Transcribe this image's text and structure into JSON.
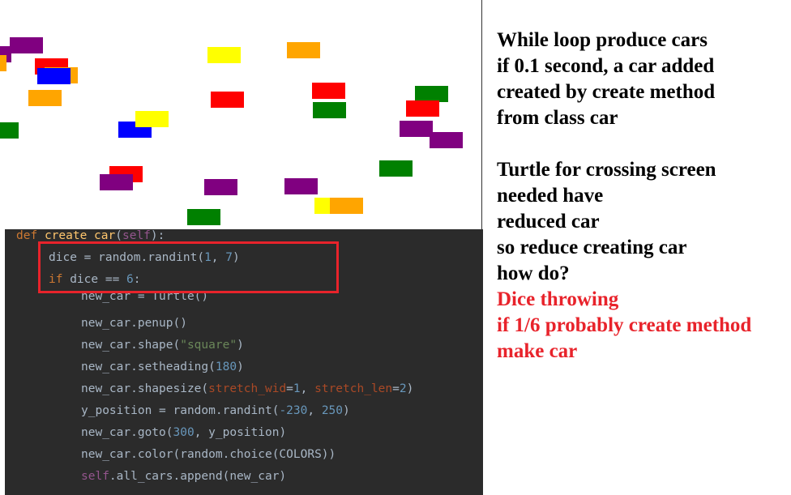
{
  "canvas": {
    "cars": [
      {
        "color": "#800080"
      },
      {
        "color": "#800080"
      },
      {
        "color": "#ffa500"
      },
      {
        "color": "#ff0000"
      },
      {
        "color": "#ffa500"
      },
      {
        "color": "#0000ff"
      },
      {
        "color": "#ffff00"
      },
      {
        "color": "#ffa500"
      },
      {
        "color": "#ffa500"
      },
      {
        "color": "#ff0000"
      },
      {
        "color": "#ff0000"
      },
      {
        "color": "#008000"
      },
      {
        "color": "#008000"
      },
      {
        "color": "#ff0000"
      },
      {
        "color": "#008000"
      },
      {
        "color": "#0000ff"
      },
      {
        "color": "#ffff00"
      },
      {
        "color": "#800080"
      },
      {
        "color": "#800080"
      },
      {
        "color": "#ff0000"
      },
      {
        "color": "#800080"
      },
      {
        "color": "#800080"
      },
      {
        "color": "#800080"
      },
      {
        "color": "#008000"
      },
      {
        "color": "#ffff00"
      },
      {
        "color": "#ffa500"
      },
      {
        "color": "#008000"
      },
      {
        "color": "#ffff00"
      }
    ]
  },
  "code": {
    "def_kw": "def",
    "def_name": "create_car",
    "def_paren_open": "(",
    "def_self": "self",
    "def_paren_close": "):",
    "l1_a": "dice = random.randint(",
    "l1_n1": "1",
    "l1_sep": ", ",
    "l1_n2": "7",
    "l1_end": ")",
    "l2_kw": "if",
    "l2_a": " dice == ",
    "l2_n": "6",
    "l2_end": ":",
    "l3": "new_car = Turtle()",
    "l4": "new_car.penup()",
    "l5_a": "new_car.shape(",
    "l5_s": "\"square\"",
    "l5_end": ")",
    "l6_a": "new_car.setheading(",
    "l6_n": "180",
    "l6_end": ")",
    "l7_a": "new_car.shapesize(",
    "l7_p1": "stretch_wid",
    "l7_eq1": "=",
    "l7_n1": "1",
    "l7_sep": ", ",
    "l7_p2": "stretch_len",
    "l7_eq2": "=",
    "l7_n2": "2",
    "l7_end": ")",
    "l8_a": "y_position = random.randint(",
    "l8_n1": "-230",
    "l8_sep": ", ",
    "l8_n2": "250",
    "l8_end": ")",
    "l9_a": "new_car.goto(",
    "l9_n": "300",
    "l9_b": ", y_position)",
    "l10": "new_car.color(random.choice(COLORS))",
    "l11_self": "self",
    "l11_b": ".all_cars.append(new_car)"
  },
  "notes": [
    {
      "text": "While loop produce cars",
      "color": "#000000"
    },
    {
      "text": "if 0.1 second,  a car added",
      "color": "#000000"
    },
    {
      "text": "created by create method",
      "color": "#000000"
    },
    {
      "text": "from class car",
      "color": "#000000"
    },
    {
      "text": "",
      "color": "#000000"
    },
    {
      "text": "Turtle   for crossing screen",
      "color": "#000000"
    },
    {
      "text": "needed    have",
      "color": "#000000"
    },
    {
      "text": "reduced car",
      "color": "#000000"
    },
    {
      "text": "so reduce creating car",
      "color": "#000000"
    },
    {
      "text": "how do?",
      "color": "#000000"
    },
    {
      "text": "Dice throwing",
      "color": "#e8232b"
    },
    {
      "text": "if 1/6 probably create method",
      "color": "#e8232b"
    },
    {
      "text": "make car",
      "color": "#e8232b"
    }
  ]
}
